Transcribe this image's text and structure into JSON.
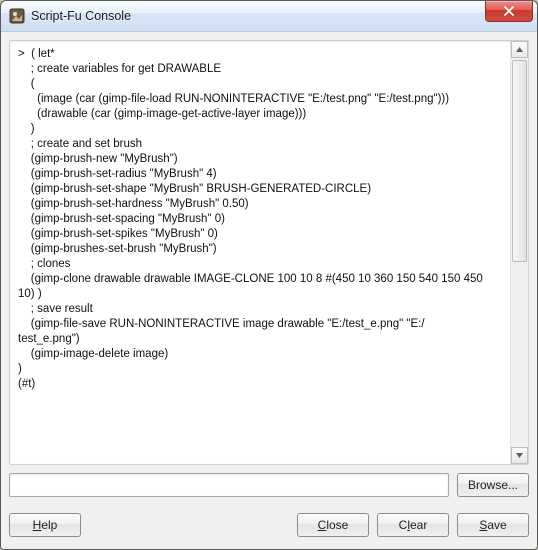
{
  "window": {
    "title": "Script-Fu Console"
  },
  "console": {
    "output": ">  ( let*\n    ; create variables for get DRAWABLE\n    (\n      (image (car (gimp-file-load RUN-NONINTERACTIVE \"E:/test.png\" \"E:/test.png\")))\n      (drawable (car (gimp-image-get-active-layer image)))\n    )\n    ; create and set brush\n    (gimp-brush-new \"MyBrush\")\n    (gimp-brush-set-radius \"MyBrush\" 4)\n    (gimp-brush-set-shape \"MyBrush\" BRUSH-GENERATED-CIRCLE)\n    (gimp-brush-set-hardness \"MyBrush\" 0.50)\n    (gimp-brush-set-spacing \"MyBrush\" 0)\n    (gimp-brush-set-spikes \"MyBrush\" 0)\n    (gimp-brushes-set-brush \"MyBrush\")\n    ; clones\n    (gimp-clone drawable drawable IMAGE-CLONE 100 10 8 #(450 10 360 150 540 150 450\n10) )\n    ; save result\n    (gimp-file-save RUN-NONINTERACTIVE image drawable \"E:/test_e.png\" \"E:/\ntest_e.png\")\n    (gimp-image-delete image)\n)\n(#t)"
  },
  "input": {
    "value": "",
    "placeholder": ""
  },
  "buttons": {
    "browse": "Browse...",
    "help": "Help",
    "close": "Close",
    "clear": "Clear",
    "save": "Save"
  }
}
